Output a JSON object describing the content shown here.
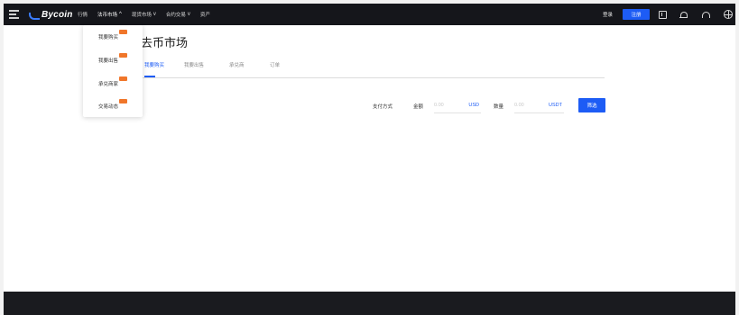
{
  "header": {
    "logo_text": "Bycoin",
    "nav": [
      {
        "label": "行情",
        "has_caret": false
      },
      {
        "label": "法币市场",
        "has_caret": true,
        "caret": "^"
      },
      {
        "label": "现货市场",
        "has_caret": true,
        "caret": "v"
      },
      {
        "label": "合约交易",
        "has_caret": true,
        "caret": "v"
      },
      {
        "label": "资产",
        "has_caret": false
      }
    ],
    "login_label": "登录",
    "register_label": "注册",
    "icons": [
      "download-icon",
      "bell-icon",
      "headset-icon",
      "globe-icon"
    ]
  },
  "dropdown": {
    "items": [
      {
        "label": "我要购买",
        "hot": true
      },
      {
        "label": "我要出售",
        "hot": true
      },
      {
        "label": "承兑商家",
        "hot": true
      },
      {
        "label": "交易动态",
        "hot": true
      }
    ]
  },
  "main": {
    "title": "法币市场",
    "title_visible": "去币市场",
    "tabs": [
      {
        "label": "我要购买",
        "active": true
      },
      {
        "label": "我要出售",
        "active": false
      },
      {
        "label": "承兑商",
        "active": false
      },
      {
        "label": "订单",
        "active": false
      }
    ],
    "filters": {
      "payment_label": "支付方式",
      "amount_label": "金额",
      "amount_placeholder": "0.00",
      "amount_unit": "USD",
      "quantity_label": "数量",
      "quantity_placeholder": "0.00",
      "quantity_unit": "USDT",
      "filter_button": "筛选"
    }
  },
  "colors": {
    "topbar": "#15161b",
    "accent": "#1d5cf5",
    "hot_badge": "#f0762a",
    "footer": "#1a1b1f"
  }
}
